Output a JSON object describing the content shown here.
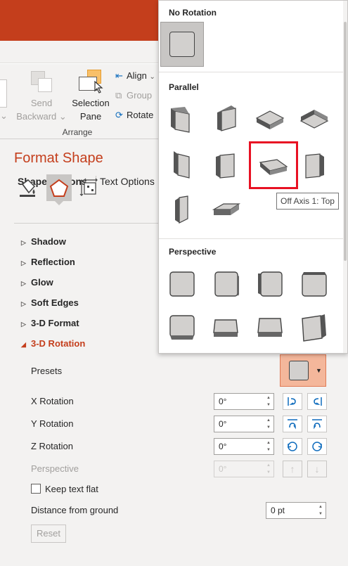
{
  "colors": {
    "accent": "#c43e1c",
    "highlight": "#e81123",
    "presets_bg": "#f4b79b"
  },
  "ribbon": {
    "send_backward": {
      "line1": "Send",
      "line2": "Backward",
      "icon": "send-backward-icon"
    },
    "selection_pane": {
      "line1": "Selection",
      "line2": "Pane",
      "icon": "selection-pane-icon"
    },
    "align": "Align",
    "group": "Group",
    "rotate": "Rotate",
    "group_label": "Arrange"
  },
  "pane": {
    "title": "Format Shape",
    "tabs": [
      "Shape Options",
      "Text Options"
    ],
    "category_icons": [
      "fill-line-icon",
      "effects-icon",
      "size-properties-icon"
    ],
    "sections": [
      "Shadow",
      "Reflection",
      "Glow",
      "Soft Edges",
      "3-D Format",
      "3-D Rotation"
    ],
    "rotation": {
      "presets_label": "Presets",
      "x_label": "X Rotation",
      "x_value": "0°",
      "y_label": "Y Rotation",
      "y_value": "0°",
      "z_label": "Z Rotation",
      "z_value": "0°",
      "perspective_label": "Perspective",
      "perspective_value": "0°",
      "keep_flat_label": "Keep text flat",
      "distance_label": "Distance from ground",
      "distance_value": "0 pt",
      "reset_label": "Reset"
    }
  },
  "dropdown": {
    "no_rotation": "No Rotation",
    "parallel": "Parallel",
    "perspective": "Perspective",
    "tooltip": "Off Axis 1: Top",
    "selected_preset": "Off Axis 1: Top"
  }
}
